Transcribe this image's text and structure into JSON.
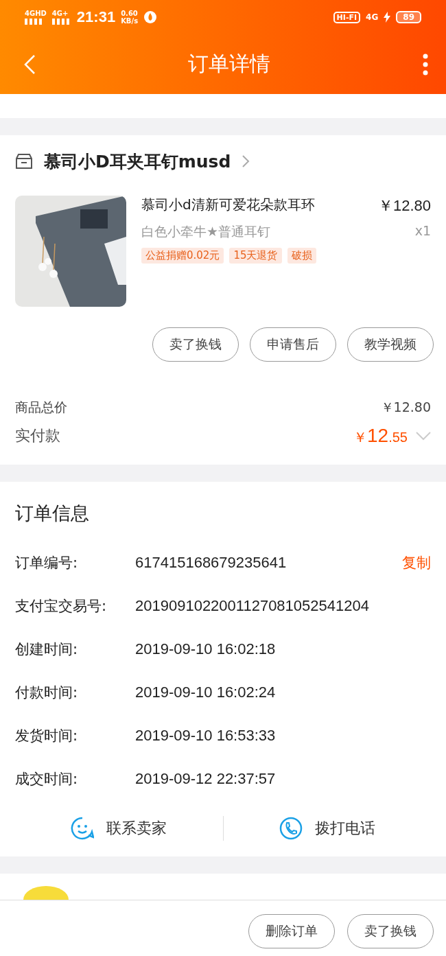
{
  "status_bar": {
    "networks": [
      "4GHD",
      "4G+"
    ],
    "time": "21:31",
    "speed": [
      "0.60",
      "KB/s"
    ],
    "hifi": "HI-FI",
    "network_right": "4G",
    "battery": "89"
  },
  "nav": {
    "title": "订单详情"
  },
  "shop": {
    "name": "慕司小D耳夹耳钉musd"
  },
  "item": {
    "title": "慕司小d清新可爱花朵款耳环",
    "price": "￥12.80",
    "spec": "白色小牵牛★普通耳钉",
    "qty": "x1",
    "tags": [
      "公益捐赠0.02元",
      "15天退货",
      "破损"
    ]
  },
  "item_actions": [
    "卖了换钱",
    "申请售后",
    "教学视频"
  ],
  "totals": {
    "goods_label": "商品总价",
    "goods_value": "￥12.80",
    "paid_label": "实付款",
    "paid_currency": "￥",
    "paid_int": "12",
    "paid_dec": ".55",
    "expanded": false
  },
  "order_info": {
    "title": "订单信息",
    "copy": "复制",
    "rows": [
      {
        "label": "订单编号:",
        "value": "617415168679235641"
      },
      {
        "label": "支付宝交易号:",
        "value": "2019091022001127081052541204"
      },
      {
        "label": "创建时间:",
        "value": "2019-09-10 16:02:18"
      },
      {
        "label": "付款时间:",
        "value": "2019-09-10 16:02:24"
      },
      {
        "label": "发货时间:",
        "value": "2019-09-10 16:53:33"
      },
      {
        "label": "成交时间:",
        "value": "2019-09-12 22:37:57"
      }
    ]
  },
  "contact": [
    {
      "kind": "chat",
      "label": "联系卖家"
    },
    {
      "kind": "phone",
      "label": "拨打电话"
    }
  ],
  "bottom_buttons": [
    "删除订单",
    "卖了换钱"
  ]
}
